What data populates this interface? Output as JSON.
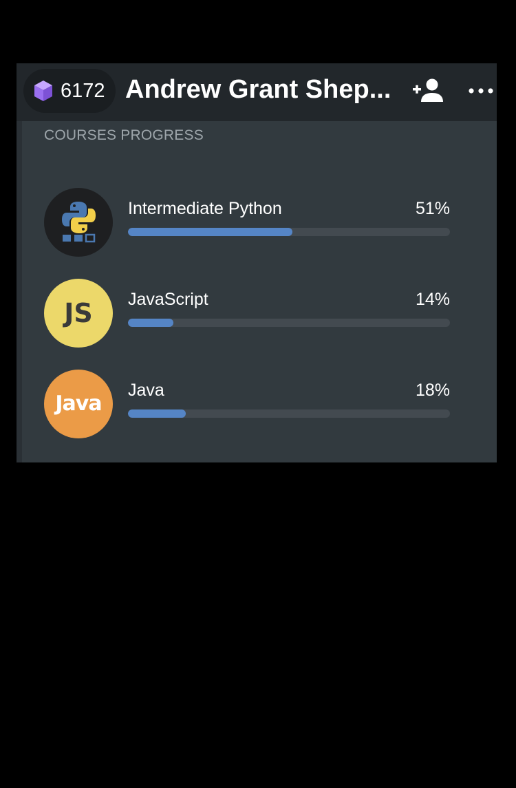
{
  "header": {
    "xp_count": "6172",
    "user_name": "Andrew Grant Shep...",
    "xp_icon": "purple-cube-icon",
    "add_friend_icon": "add-person-icon",
    "more_icon": "more-dots-icon"
  },
  "section_title": "COURSES PROGRESS",
  "courses": [
    {
      "name": "Intermediate Python",
      "percent_label": "51%",
      "progress": 0.51,
      "icon": "python-icon",
      "icon_color": "#1e1f21"
    },
    {
      "name": "JavaScript",
      "percent_label": "14%",
      "progress": 0.14,
      "icon": "javascript-icon",
      "icon_label": "JS",
      "icon_color": "#ecd86a"
    },
    {
      "name": "Java",
      "percent_label": "18%",
      "progress": 0.18,
      "icon": "java-icon",
      "icon_label": "Java",
      "icon_color": "#eb9b47"
    }
  ],
  "colors": {
    "progress_fill": "#5585c6",
    "progress_track": "#434a50",
    "card_background": "#323a3f",
    "header_background": "#22272b"
  }
}
